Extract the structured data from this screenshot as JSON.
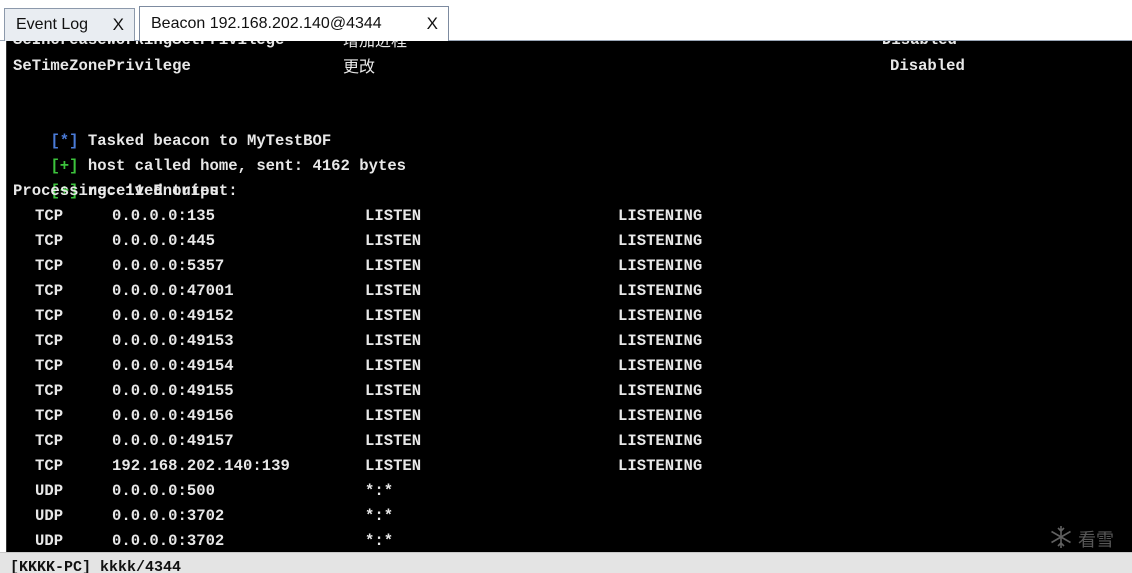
{
  "tabs": [
    {
      "label": "Event Log",
      "close": "X"
    },
    {
      "label": "Beacon 192.168.202.140@4344",
      "close": "X"
    }
  ],
  "console": {
    "privileges": [
      {
        "name": "SeIncreaseWorkingSetPrivilege",
        "desc": "增加进程",
        "state": "Disabled"
      },
      {
        "name": "SeTimeZonePrivilege",
        "desc": "更改",
        "state": "Disabled"
      }
    ],
    "messages": [
      {
        "tag": "[*]",
        "tag_color": "#4a7bd8",
        "text": " Tasked beacon to MyTestBOF"
      },
      {
        "tag": "[+]",
        "tag_color": "#3cc23c",
        "text": " host called home, sent: 4162 bytes"
      },
      {
        "tag": "[+]",
        "tag_color": "#3cc23c",
        "text": " received output:"
      }
    ],
    "processing": "Processing: 11 Entries",
    "entries": [
      {
        "proto": "TCP",
        "addr": "0.0.0.0:135",
        "remote": "LISTEN",
        "state": "LISTENING"
      },
      {
        "proto": "TCP",
        "addr": "0.0.0.0:445",
        "remote": "LISTEN",
        "state": "LISTENING"
      },
      {
        "proto": "TCP",
        "addr": "0.0.0.0:5357",
        "remote": "LISTEN",
        "state": "LISTENING"
      },
      {
        "proto": "TCP",
        "addr": "0.0.0.0:47001",
        "remote": "LISTEN",
        "state": "LISTENING"
      },
      {
        "proto": "TCP",
        "addr": "0.0.0.0:49152",
        "remote": "LISTEN",
        "state": "LISTENING"
      },
      {
        "proto": "TCP",
        "addr": "0.0.0.0:49153",
        "remote": "LISTEN",
        "state": "LISTENING"
      },
      {
        "proto": "TCP",
        "addr": "0.0.0.0:49154",
        "remote": "LISTEN",
        "state": "LISTENING"
      },
      {
        "proto": "TCP",
        "addr": "0.0.0.0:49155",
        "remote": "LISTEN",
        "state": "LISTENING"
      },
      {
        "proto": "TCP",
        "addr": "0.0.0.0:49156",
        "remote": "LISTEN",
        "state": "LISTENING"
      },
      {
        "proto": "TCP",
        "addr": "0.0.0.0:49157",
        "remote": "LISTEN",
        "state": "LISTENING"
      },
      {
        "proto": "TCP",
        "addr": "192.168.202.140:139",
        "remote": "LISTEN",
        "state": "LISTENING"
      },
      {
        "proto": "UDP",
        "addr": "0.0.0.0:500",
        "remote": "*:*",
        "state": ""
      },
      {
        "proto": "UDP",
        "addr": "0.0.0.0:3702",
        "remote": "*:*",
        "state": ""
      },
      {
        "proto": "UDP",
        "addr": "0.0.0.0:3702",
        "remote": "*:*",
        "state": ""
      }
    ],
    "watermark": "看雪"
  },
  "statusbar": {
    "text": "[KKKK-PC] kkkk/4344"
  },
  "colors": {
    "console_bg": "#000000",
    "console_text": "#e8e8e8",
    "info_tag": "#4a7bd8",
    "success_tag": "#3cc23c"
  },
  "icons": {
    "watermark_logo": "snowflake-icon"
  }
}
